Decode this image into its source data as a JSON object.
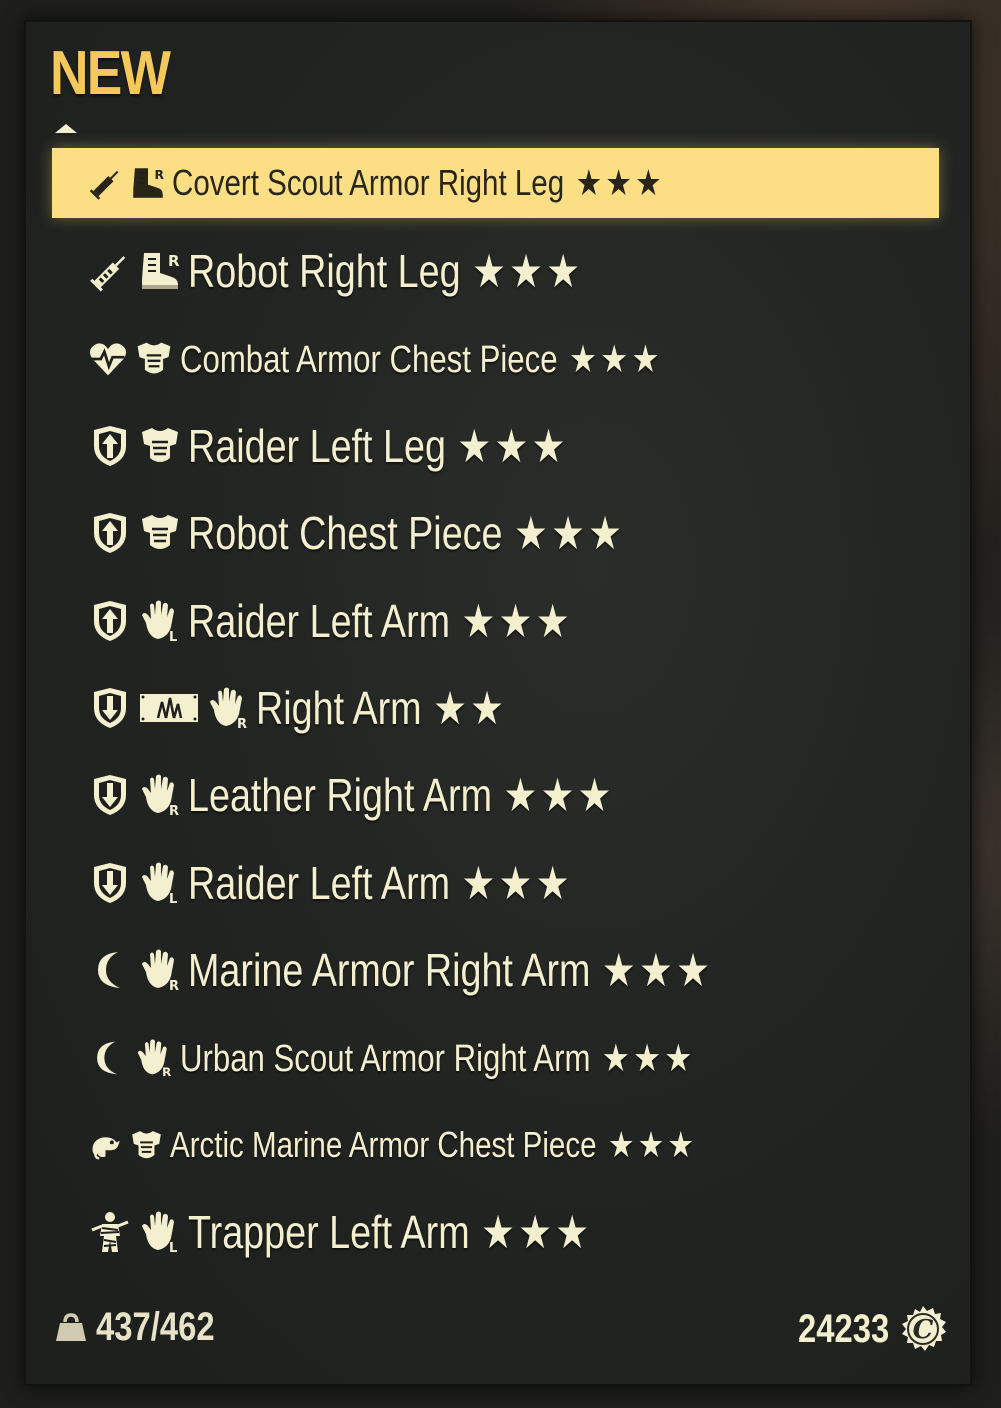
{
  "header": {
    "title": "NEW"
  },
  "colors": {
    "accent": "#f5c85c",
    "text": "#f4efcf",
    "selected_bg": "#fcdf85"
  },
  "items": [
    {
      "label": "Covert Scout Armor Right Leg",
      "stars": "★★★",
      "icons": [
        "syringe-icon",
        "boot-right-icon"
      ],
      "selected": true
    },
    {
      "label": "Robot Right Leg",
      "stars": "★★★",
      "icons": [
        "syringe-icon",
        "boot-right-icon"
      ]
    },
    {
      "label": "Combat Armor Chest Piece",
      "stars": "★★★",
      "icons": [
        "heartbeat-icon",
        "chest-armor-icon"
      ]
    },
    {
      "label": "Raider Left Leg",
      "stars": "★★★",
      "icons": [
        "shield-up-arrow-icon",
        "chest-armor-icon"
      ]
    },
    {
      "label": "Robot Chest Piece",
      "stars": "★★★",
      "icons": [
        "shield-up-arrow-icon",
        "chest-armor-icon"
      ]
    },
    {
      "label": "Raider Left Arm",
      "stars": "★★★",
      "icons": [
        "shield-up-arrow-icon",
        "glove-left-icon"
      ]
    },
    {
      "label": "Right Arm",
      "stars": "★★",
      "icons": [
        "shield-down-arrow-icon",
        "crystal-card-icon",
        "glove-right-icon"
      ]
    },
    {
      "label": "Leather Right Arm",
      "stars": "★★★",
      "icons": [
        "shield-down-arrow-icon",
        "glove-right-icon"
      ]
    },
    {
      "label": "Raider Left Arm",
      "stars": "★★★",
      "icons": [
        "shield-down-arrow-icon",
        "glove-left-icon"
      ]
    },
    {
      "label": "Marine Armor Right Arm",
      "stars": "★★★",
      "icons": [
        "crescent-moon-icon",
        "glove-right-icon"
      ]
    },
    {
      "label": "Urban Scout Armor Right Arm",
      "stars": "★★★",
      "icons": [
        "crescent-moon-icon",
        "glove-right-icon"
      ]
    },
    {
      "label": "Arctic Marine Armor Chest Piece",
      "stars": "★★★",
      "icons": [
        "chameleon-icon",
        "chest-armor-icon"
      ]
    },
    {
      "label": "Trapper Left Arm",
      "stars": "★★★",
      "icons": [
        "mummy-icon",
        "glove-left-icon"
      ]
    }
  ],
  "footer": {
    "carry_weight": "437/462",
    "caps": "24233"
  }
}
